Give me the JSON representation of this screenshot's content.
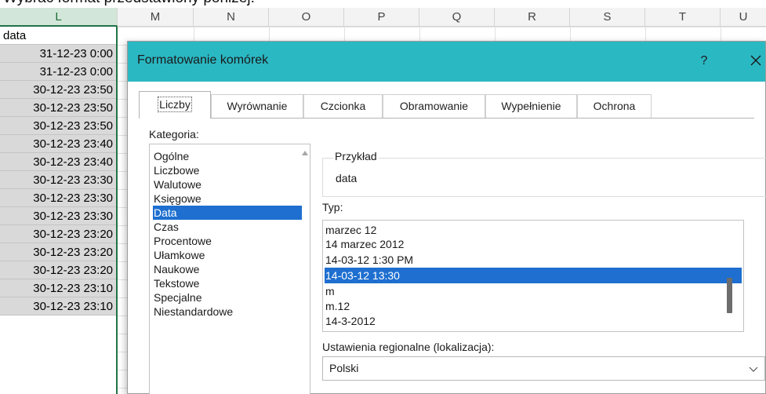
{
  "page": {
    "top_text": "Wybrać format przedstawiony poniżej:"
  },
  "spreadsheet": {
    "columns": [
      "L",
      "M",
      "N",
      "O",
      "P",
      "Q",
      "R",
      "S",
      "T",
      "U"
    ],
    "column_l_cells": [
      "data",
      "31-12-23 0:00",
      "31-12-23 0:00",
      "30-12-23 23:50",
      "30-12-23 23:50",
      "30-12-23 23:50",
      "30-12-23 23:40",
      "30-12-23 23:40",
      "30-12-23 23:30",
      "30-12-23 23:30",
      "30-12-23 23:30",
      "30-12-23 23:20",
      "30-12-23 23:20",
      "30-12-23 23:20",
      "30-12-23 23:10",
      "30-12-23 23:10"
    ]
  },
  "dialog": {
    "title": "Formatowanie komórek",
    "help_label": "?",
    "tabs": [
      "Liczby",
      "Wyrównanie",
      "Czcionka",
      "Obramowanie",
      "Wypełnienie",
      "Ochrona"
    ],
    "active_tab": "Liczby",
    "category_label": "Kategoria:",
    "categories": [
      "Ogólne",
      "Liczbowe",
      "Walutowe",
      "Księgowe",
      "Data",
      "Czas",
      "Procentowe",
      "Ułamkowe",
      "Naukowe",
      "Tekstowe",
      "Specjalne",
      "Niestandardowe"
    ],
    "selected_category": "Data",
    "sample_label": "Przykład",
    "sample_value": "data",
    "type_label": "Typ:",
    "types": [
      "marzec 12",
      "14 marzec 2012",
      "14-03-12 1:30 PM",
      "14-03-12 13:30",
      "m",
      "m.12",
      "14-3-2012"
    ],
    "selected_type": "14-03-12 13:30",
    "locale_label": "Ustawienia regionalne (lokalizacja):",
    "locale_value": "Polski"
  },
  "colors": {
    "titlebar": "#2ab8c3",
    "selection": "#1e6fd0",
    "excel_green": "#217346",
    "selected_cell_bg": "#d9d9d9"
  },
  "icons": {
    "close": "close-icon",
    "scroll_up": "scroll-up-arrow-icon",
    "dropdown": "chevron-down-icon"
  }
}
